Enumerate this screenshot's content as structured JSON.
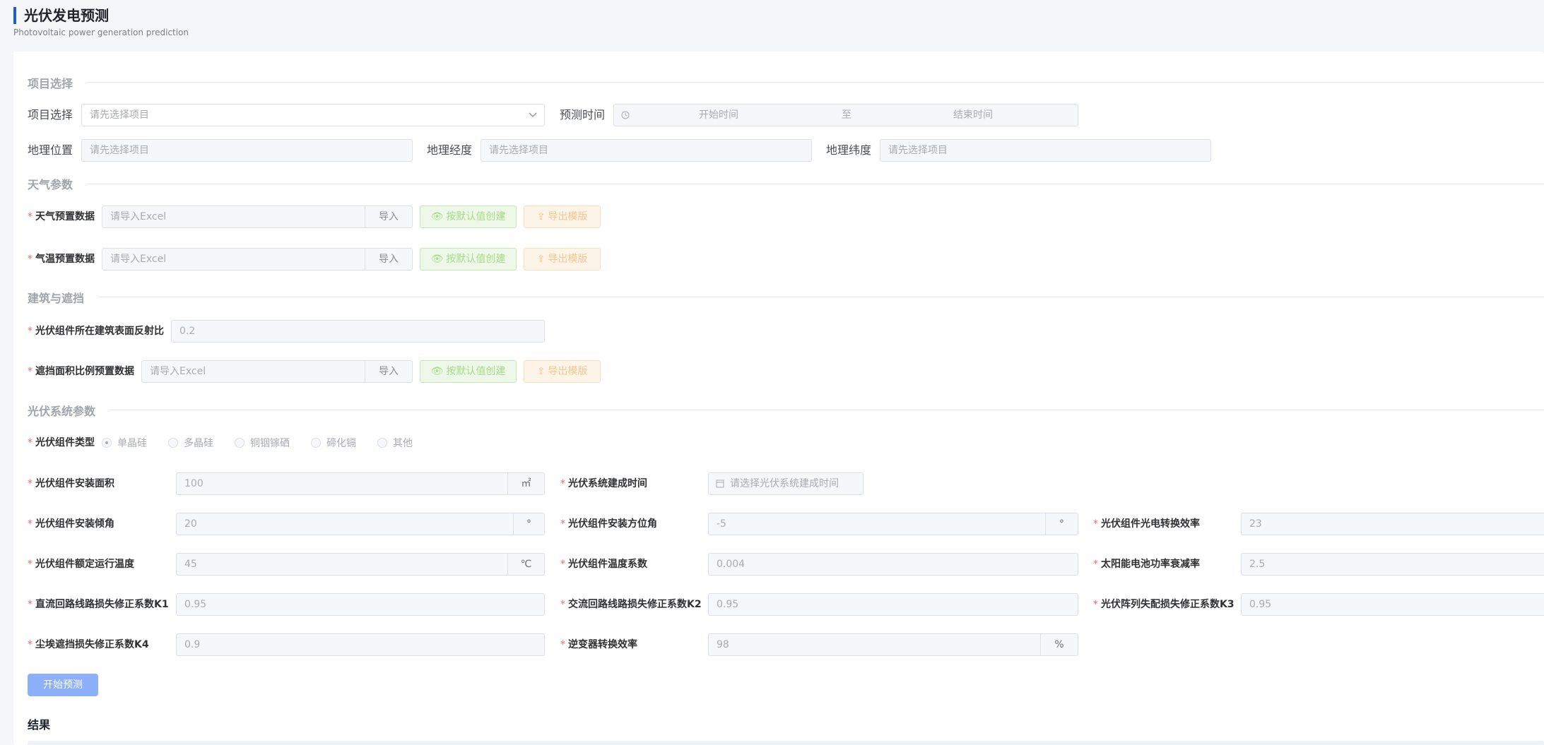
{
  "header": {
    "title": "光伏发电预测",
    "subtitle": "Photovoltaic power generation prediction"
  },
  "sections": {
    "project": "项目选择",
    "weather": "天气参数",
    "building": "建筑与遮挡",
    "pvsystem": "光伏系统参数"
  },
  "project": {
    "select_label": "项目选择",
    "select_placeholder": "请先选择项目",
    "time_label": "预测时间",
    "time_start": "开始时间",
    "time_sep": "至",
    "time_end": "结束时间",
    "location_label": "地理位置",
    "location_placeholder": "请先选择项目",
    "longitude_label": "地理经度",
    "longitude_placeholder": "请先选择项目",
    "latitude_label": "地理纬度",
    "latitude_placeholder": "请先选择项目"
  },
  "weather": {
    "forecast_label": "天气预置数据",
    "temp_label": "气温预置数据",
    "excel_placeholder": "请导入Excel",
    "import_label": "导入",
    "default_create_label": "按默认值创建",
    "export_template_label": "导出模版"
  },
  "building": {
    "reflectance_label": "光伏组件所在建筑表面反射比",
    "reflectance_value": "0.2",
    "shading_label": "遮挡面积比例预置数据"
  },
  "pv": {
    "type_label": "光伏组件类型",
    "types": [
      "单晶硅",
      "多晶硅",
      "铜铟镓硒",
      "碲化镉",
      "其他"
    ],
    "selected_type": "单晶硅",
    "area_label": "光伏组件安装面积",
    "area_value": "100",
    "area_unit": "㎡",
    "build_time_label": "光伏系统建成时间",
    "build_time_placeholder": "请选择光伏系统建成时间",
    "tilt_label": "光伏组件安装倾角",
    "tilt_value": "20",
    "tilt_unit": "°",
    "azimuth_label": "光伏组件安装方位角",
    "azimuth_value": "-5",
    "azimuth_unit": "°",
    "efficiency_label": "光伏组件光电转换效率",
    "efficiency_value": "23",
    "rated_temp_label": "光伏组件额定运行温度",
    "rated_temp_value": "45",
    "rated_temp_unit": "℃",
    "temp_coef_label": "光伏组件温度系数",
    "temp_coef_value": "0.004",
    "decay_label": "太阳能电池功率衰减率",
    "decay_value": "2.5",
    "k1_label": "直流回路线路损失修正系数K1",
    "k1_value": "0.95",
    "k2_label": "交流回路线路损失修正系数K2",
    "k2_value": "0.95",
    "k3_label": "光伏阵列失配损失修正系数K3",
    "k3_value": "0.95",
    "k4_label": "尘埃遮挡损失修正系数K4",
    "k4_value": "0.9",
    "inverter_label": "逆变器转换效率",
    "inverter_value": "98",
    "inverter_unit": "%"
  },
  "actions": {
    "start_label": "开始预测"
  },
  "results": {
    "title": "结果"
  },
  "colors": {
    "accent": "#1e5bd7",
    "primary_button": "#8db0fa",
    "required_star": "#f56c6c"
  }
}
